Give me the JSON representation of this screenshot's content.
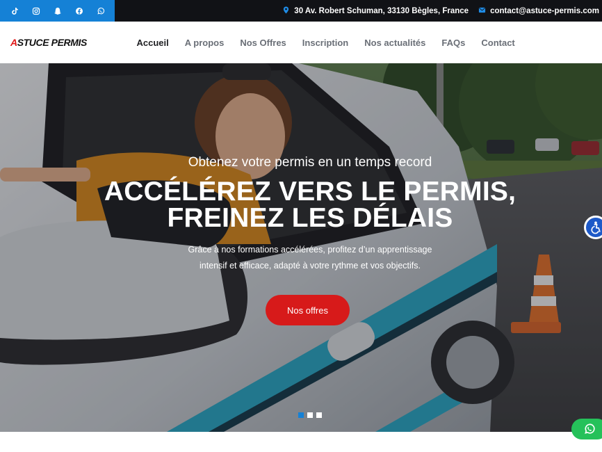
{
  "topbar": {
    "social_icons": [
      "tiktok-icon",
      "instagram-icon",
      "snapchat-icon",
      "facebook-icon",
      "whatsapp-icon"
    ],
    "address": "30 Av. Robert Schuman, 33130 Bègles, France",
    "email": "contact@astuce-permis.com"
  },
  "logo": {
    "first": "A",
    "rest": "STUCE PERMIS"
  },
  "nav": {
    "items": [
      "Accueil",
      "A propos",
      "Nos Offres",
      "Inscription",
      "Nos actualités",
      "FAQs",
      "Contact"
    ],
    "active": "Accueil"
  },
  "hero": {
    "kicker": "Obtenez votre permis en un temps record",
    "headline_line1": "ACCÉLÉREZ VERS LE PERMIS,",
    "headline_line2": "FREINEZ LES DÉLAIS",
    "desc_line1": "Grâce à nos formations accélérées, profitez d’un apprentissage",
    "desc_line2": "intensif et efficace, adapté à votre rythme et vos objectifs.",
    "cta": "Nos offres",
    "slide_count": 3,
    "active_slide": 1
  },
  "colors": {
    "topbar_bg": "#111216",
    "social_bg": "#1581d6",
    "cta_bg": "#d71a1a",
    "logo_accent": "#e01818",
    "accessibility_bg": "#1d59c8",
    "whatsapp_bg": "#25c15a"
  },
  "floating": {
    "accessibility_icon": "accessibility-icon",
    "whatsapp_icon": "whatsapp-icon"
  }
}
